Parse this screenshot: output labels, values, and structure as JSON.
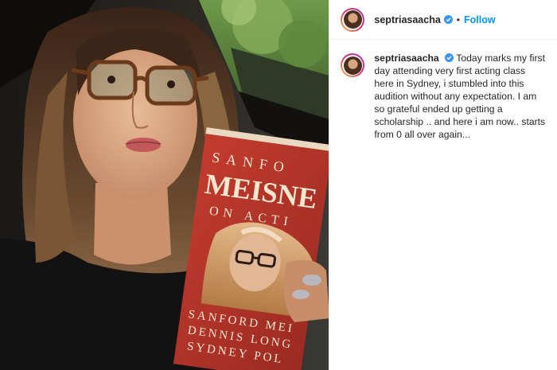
{
  "post": {
    "username": "septriasaacha",
    "follow_label": "Follow",
    "separator": "•",
    "caption": "Today marks my first day attending very first acting class here in Sydney, i stumbled into this audition without any expectation. I am so grateful ended up getting a scholarship .. and here i am now.. starts from 0 all over again...",
    "verified_icon": "verified-badge-icon"
  },
  "book": {
    "cover_top": "SANFO",
    "cover_title": "MEISNE",
    "cover_sub": "ON ACTI",
    "author1": "SANFORD MEI",
    "author2": "DENNIS LONG",
    "author3": "SYDNEY POL"
  },
  "colors": {
    "follow_blue": "#0095f6",
    "verified_blue": "#3897f0",
    "book_red": "#b8352a"
  }
}
